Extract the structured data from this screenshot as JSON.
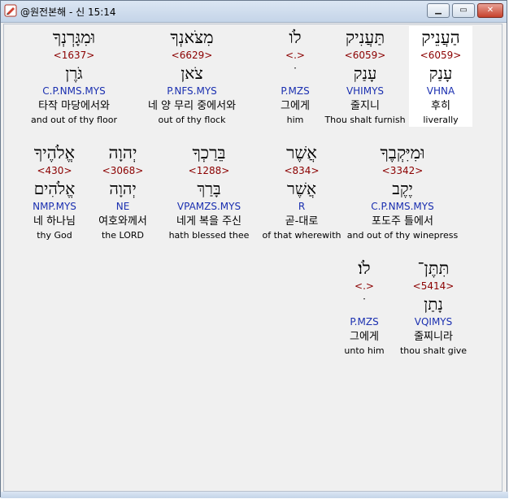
{
  "window": {
    "title": "@원전본해 - 신 15:14",
    "controls": {
      "minimize": "▁",
      "maximize": "▭",
      "close": "✕"
    }
  },
  "rows": [
    [
      {
        "hebrew": "הַעֲנֵיק",
        "strong": "<6059>",
        "root": "עָנַק",
        "morph": "VHNA",
        "korean": "후히",
        "english": "liverally",
        "highlight": true
      },
      {
        "hebrew": "תַּעֲנִיק",
        "strong": "<6059>",
        "root": "עָנַק",
        "morph": "VHIMYS",
        "korean": "줄지니",
        "english": "Thou shalt furnish"
      },
      {
        "hebrew": "לֹו",
        "strong": "<.>",
        "root": "ׂ",
        "morph": "P.MZS",
        "korean": "그에게",
        "english": "him"
      },
      {
        "hebrew": "מִצֹּאנְךָ",
        "strong": "<6629>",
        "root": "צֹאן",
        "morph": "P.NFS.MYS",
        "korean": "네 양 무리 중에서와",
        "english": "out of thy flock"
      },
      {
        "hebrew": "וּמִגָּרְנְךָ",
        "strong": "<1637>",
        "root": "גֹּרֶן",
        "morph": "C.P.NMS.MYS",
        "korean": "타작 마당에서와",
        "english": "and out of thy floor"
      }
    ],
    [
      {
        "hebrew": "וּמִיִּקְבֶךָ",
        "strong": "<3342>",
        "root": "יֶקֶב",
        "morph": "C.P.NMS.MYS",
        "korean": "포도주 틀에서",
        "english": "and out of thy winepress"
      },
      {
        "hebrew": "אֲשֶׁר",
        "strong": "<834>",
        "root": "אֲשֶׁר",
        "morph": "R",
        "korean": "곧-대로",
        "english": "of that wherewith"
      },
      {
        "hebrew": "בֵּרַכְךָ",
        "strong": "<1288>",
        "root": "בָּרַךְ",
        "morph": "VPAMZS.MYS",
        "korean": "네게 복을 주신",
        "english": "hath blessed thee"
      },
      {
        "hebrew": "יְהוָה",
        "strong": "<3068>",
        "root": "יְהוָה",
        "morph": "NE",
        "korean": "여호와께서",
        "english": "the LORD"
      },
      {
        "hebrew": "אֱלֹהֶיךָ",
        "strong": "<430>",
        "root": "אֱלֹהִים",
        "morph": "NMP.MYS",
        "korean": "네 하나님",
        "english": "thy God"
      }
    ],
    [
      {
        "hebrew": "תִּתֶּן־",
        "strong": "<5414>",
        "root": "נָתַן",
        "morph": "VQIMYS",
        "korean": "줄찌니라",
        "english": "thou shalt give"
      },
      {
        "hebrew": "לֹו׃",
        "strong": "<.>",
        "root": "ׂ",
        "morph": "P.MZS",
        "korean": "그에게",
        "english": "unto him"
      }
    ]
  ]
}
